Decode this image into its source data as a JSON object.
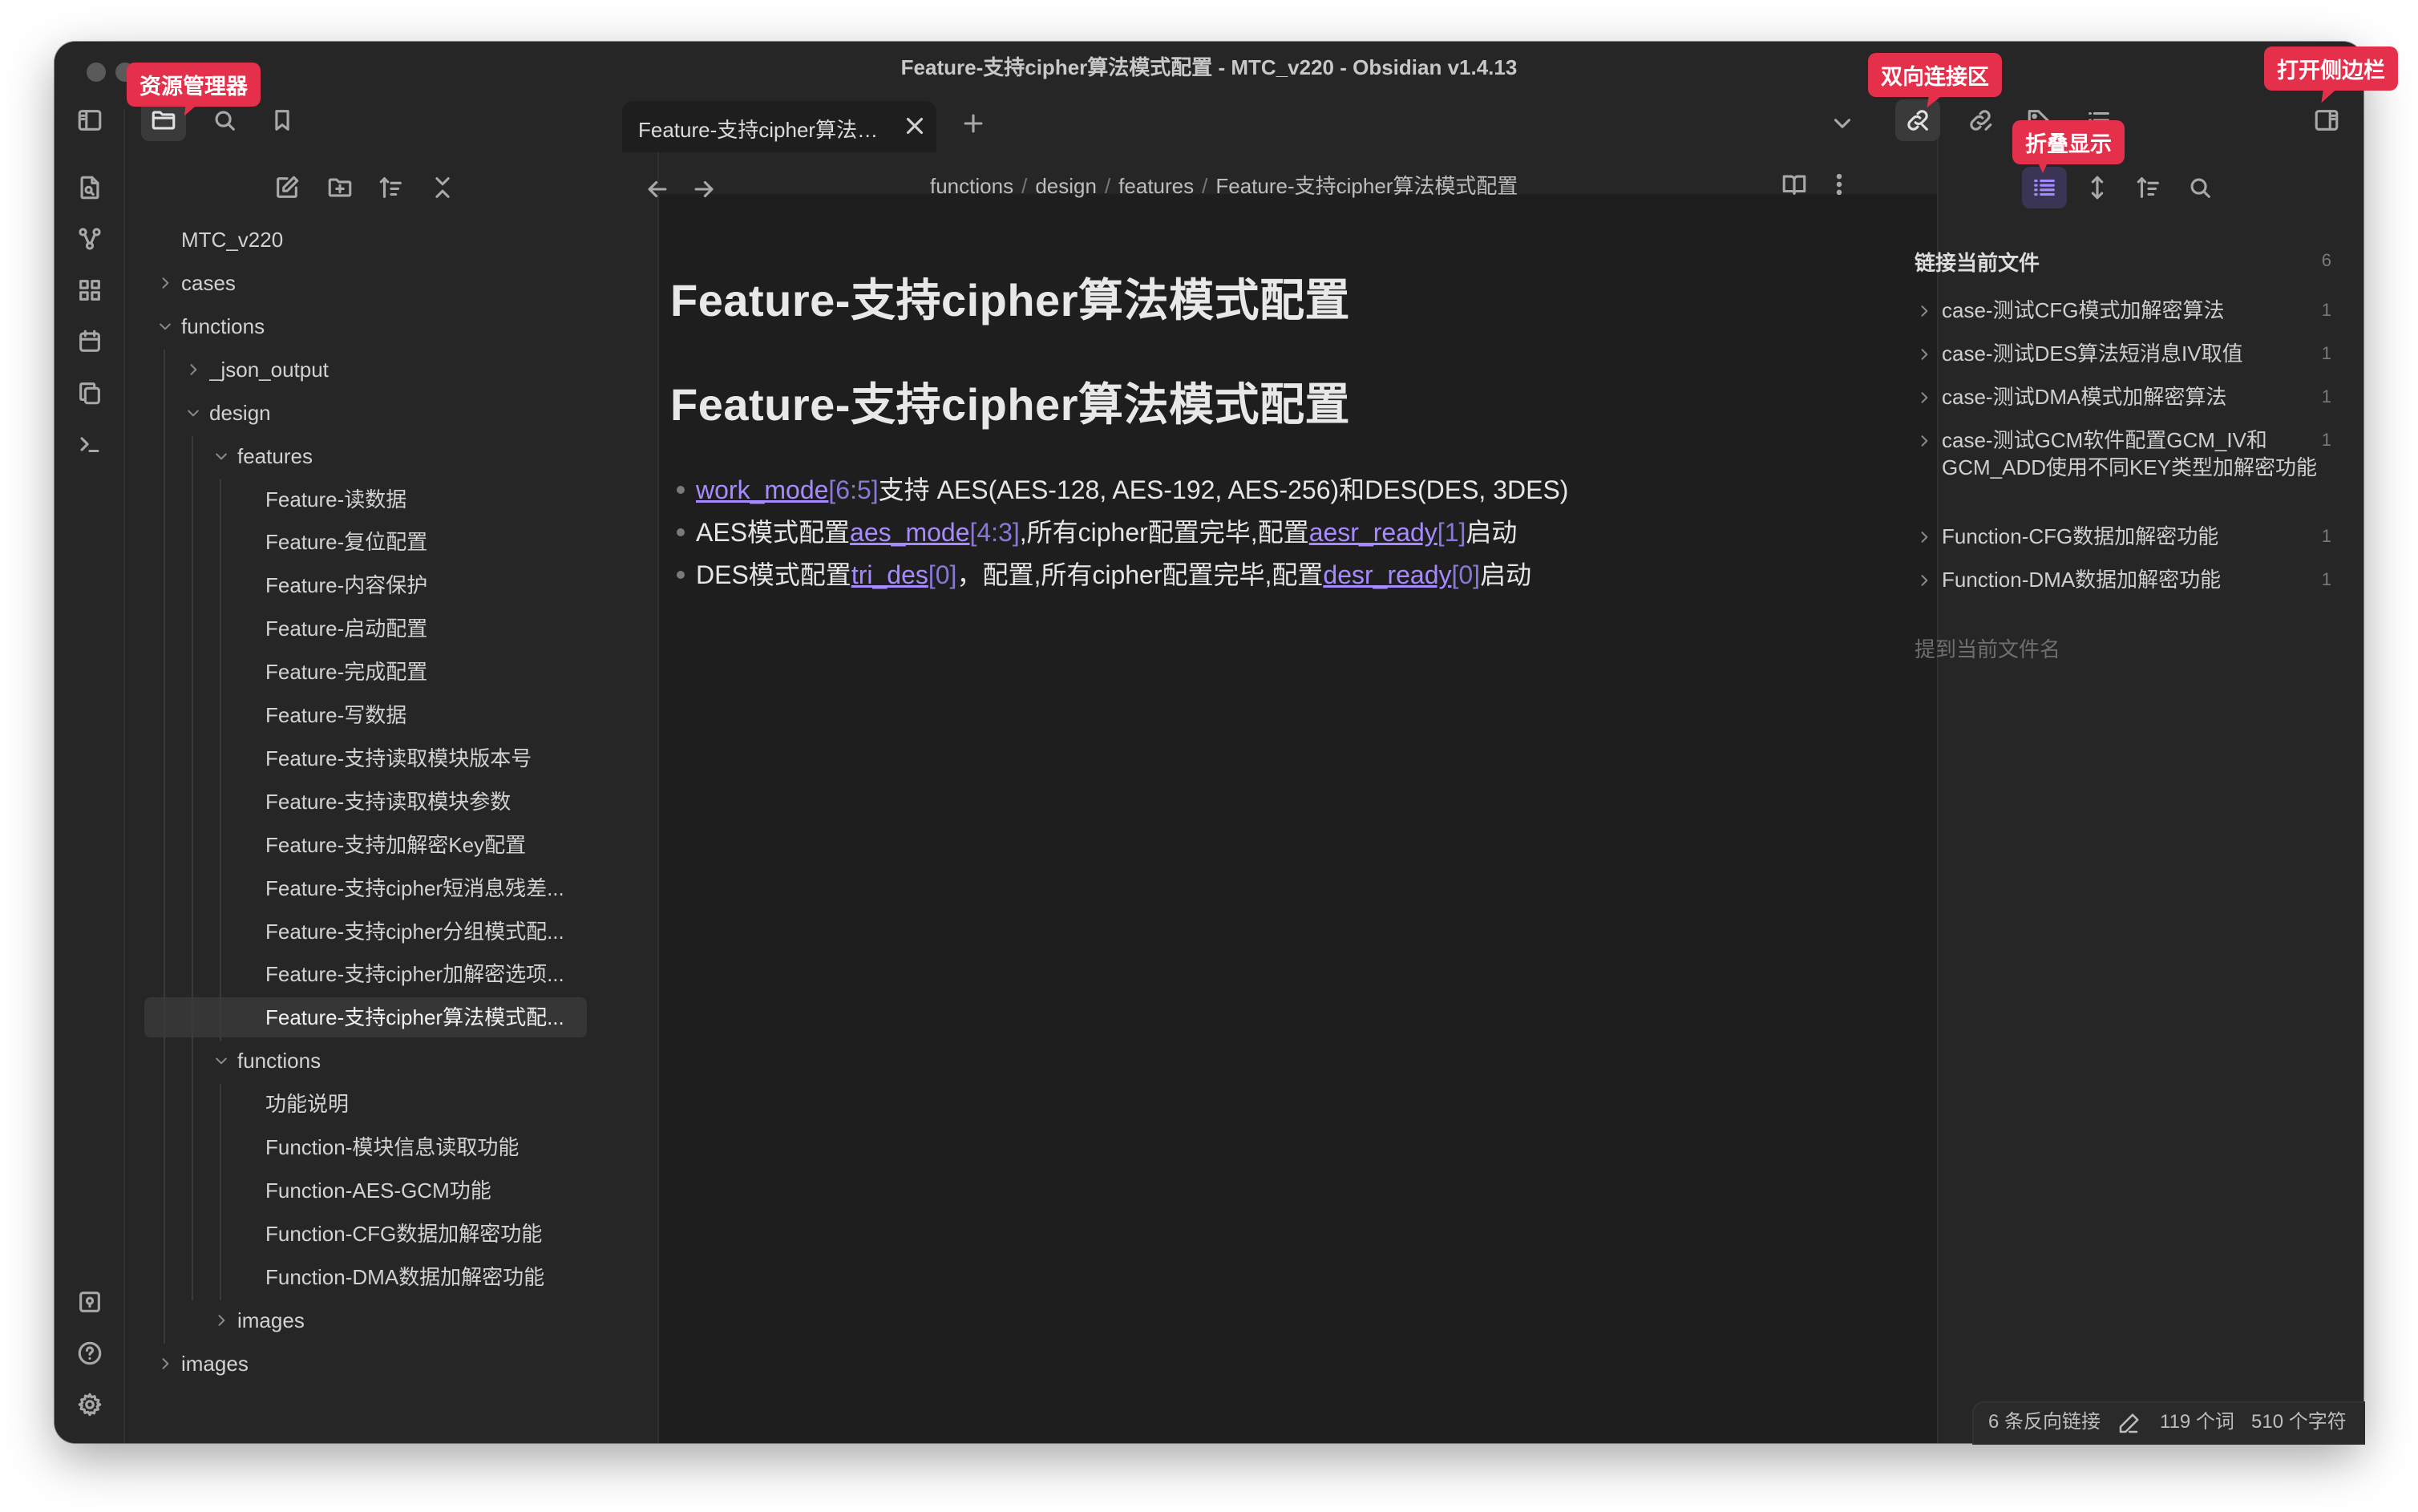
{
  "window": {
    "title": "Feature-支持cipher算法模式配置 - MTC_v220 - Obsidian v1.4.13"
  },
  "annotations": {
    "explorer": "资源管理器",
    "backlinks": "双向连接区",
    "collapse": "折叠显示",
    "open_sidebar": "打开侧边栏"
  },
  "tab": {
    "label": "Feature-支持cipher算法模式配置"
  },
  "breadcrumb": [
    "functions",
    "design",
    "features",
    "Feature-支持cipher算法模式配置"
  ],
  "vault": {
    "name": "MTC_v220"
  },
  "tree": [
    {
      "label": "cases",
      "level": 0,
      "type": "folder",
      "expanded": false
    },
    {
      "label": "functions",
      "level": 0,
      "type": "folder",
      "expanded": true
    },
    {
      "label": "_json_output",
      "level": 1,
      "type": "folder",
      "expanded": false
    },
    {
      "label": "design",
      "level": 1,
      "type": "folder",
      "expanded": true
    },
    {
      "label": "features",
      "level": 2,
      "type": "folder",
      "expanded": true
    },
    {
      "label": "Feature-读数据",
      "level": 3,
      "type": "file"
    },
    {
      "label": "Feature-复位配置",
      "level": 3,
      "type": "file"
    },
    {
      "label": "Feature-内容保护",
      "level": 3,
      "type": "file"
    },
    {
      "label": "Feature-启动配置",
      "level": 3,
      "type": "file"
    },
    {
      "label": "Feature-完成配置",
      "level": 3,
      "type": "file"
    },
    {
      "label": "Feature-写数据",
      "level": 3,
      "type": "file"
    },
    {
      "label": "Feature-支持读取模块版本号",
      "level": 3,
      "type": "file"
    },
    {
      "label": "Feature-支持读取模块参数",
      "level": 3,
      "type": "file"
    },
    {
      "label": "Feature-支持加解密Key配置",
      "level": 3,
      "type": "file"
    },
    {
      "label": "Feature-支持cipher短消息残差...",
      "level": 3,
      "type": "file"
    },
    {
      "label": "Feature-支持cipher分组模式配...",
      "level": 3,
      "type": "file"
    },
    {
      "label": "Feature-支持cipher加解密选项...",
      "level": 3,
      "type": "file"
    },
    {
      "label": "Feature-支持cipher算法模式配...",
      "level": 3,
      "type": "file",
      "active": true
    },
    {
      "label": "functions",
      "level": 2,
      "type": "folder",
      "expanded": true
    },
    {
      "label": "功能说明",
      "level": 3,
      "type": "file"
    },
    {
      "label": "Function-模块信息读取功能",
      "level": 3,
      "type": "file"
    },
    {
      "label": "Function-AES-GCM功能",
      "level": 3,
      "type": "file"
    },
    {
      "label": "Function-CFG数据加解密功能",
      "level": 3,
      "type": "file"
    },
    {
      "label": "Function-DMA数据加解密功能",
      "level": 3,
      "type": "file"
    },
    {
      "label": "images",
      "level": 2,
      "type": "folder",
      "expanded": false
    },
    {
      "label": "images",
      "level": 0,
      "type": "folder",
      "expanded": false
    }
  ],
  "document": {
    "title": "Feature-支持cipher算法模式配置",
    "heading": "Feature-支持cipher算法模式配置",
    "bullets": [
      {
        "link": "work_mode",
        "index": "[6:5]",
        "rest": "支持 AES(AES-128, AES-192, AES-256)和DES(DES, 3DES)"
      },
      {
        "pre": "AES模式配置",
        "link": "aes_mode",
        "index": "[4:3]",
        "mid": ",所有cipher配置完毕,配置",
        "link2": "aesr_ready",
        "index2": "[1]",
        "post": "启动"
      },
      {
        "pre": "DES模式配置",
        "link": "tri_des",
        "index": "[0]",
        "mid": "，配置,所有cipher配置完毕,配置",
        "link2": "desr_ready",
        "index2": "[0]",
        "post": "启动"
      }
    ]
  },
  "backlinks": {
    "section_title": "链接当前文件",
    "count": "6",
    "items": [
      {
        "label": "case-测试CFG模式加解密算法",
        "count": "1"
      },
      {
        "label": "case-测试DES算法短消息IV取值",
        "count": "1"
      },
      {
        "label": "case-测试DMA模式加解密算法",
        "count": "1"
      },
      {
        "label": "case-测试GCM软件配置GCM_IV和GCM_ADD使用不同KEY类型加解密功能",
        "count": "1"
      },
      {
        "label": "Function-CFG数据加解密功能",
        "count": "1"
      },
      {
        "label": "Function-DMA数据加解密功能",
        "count": "1"
      }
    ],
    "unlinked_title": "提到当前文件名"
  },
  "status": {
    "backlinks": "6 条反向链接",
    "words": "119 个词",
    "chars": "510 个字符"
  },
  "colors": {
    "accent": "#a58bff",
    "annotation": "#e4304b",
    "background": "#1e1e1e"
  }
}
